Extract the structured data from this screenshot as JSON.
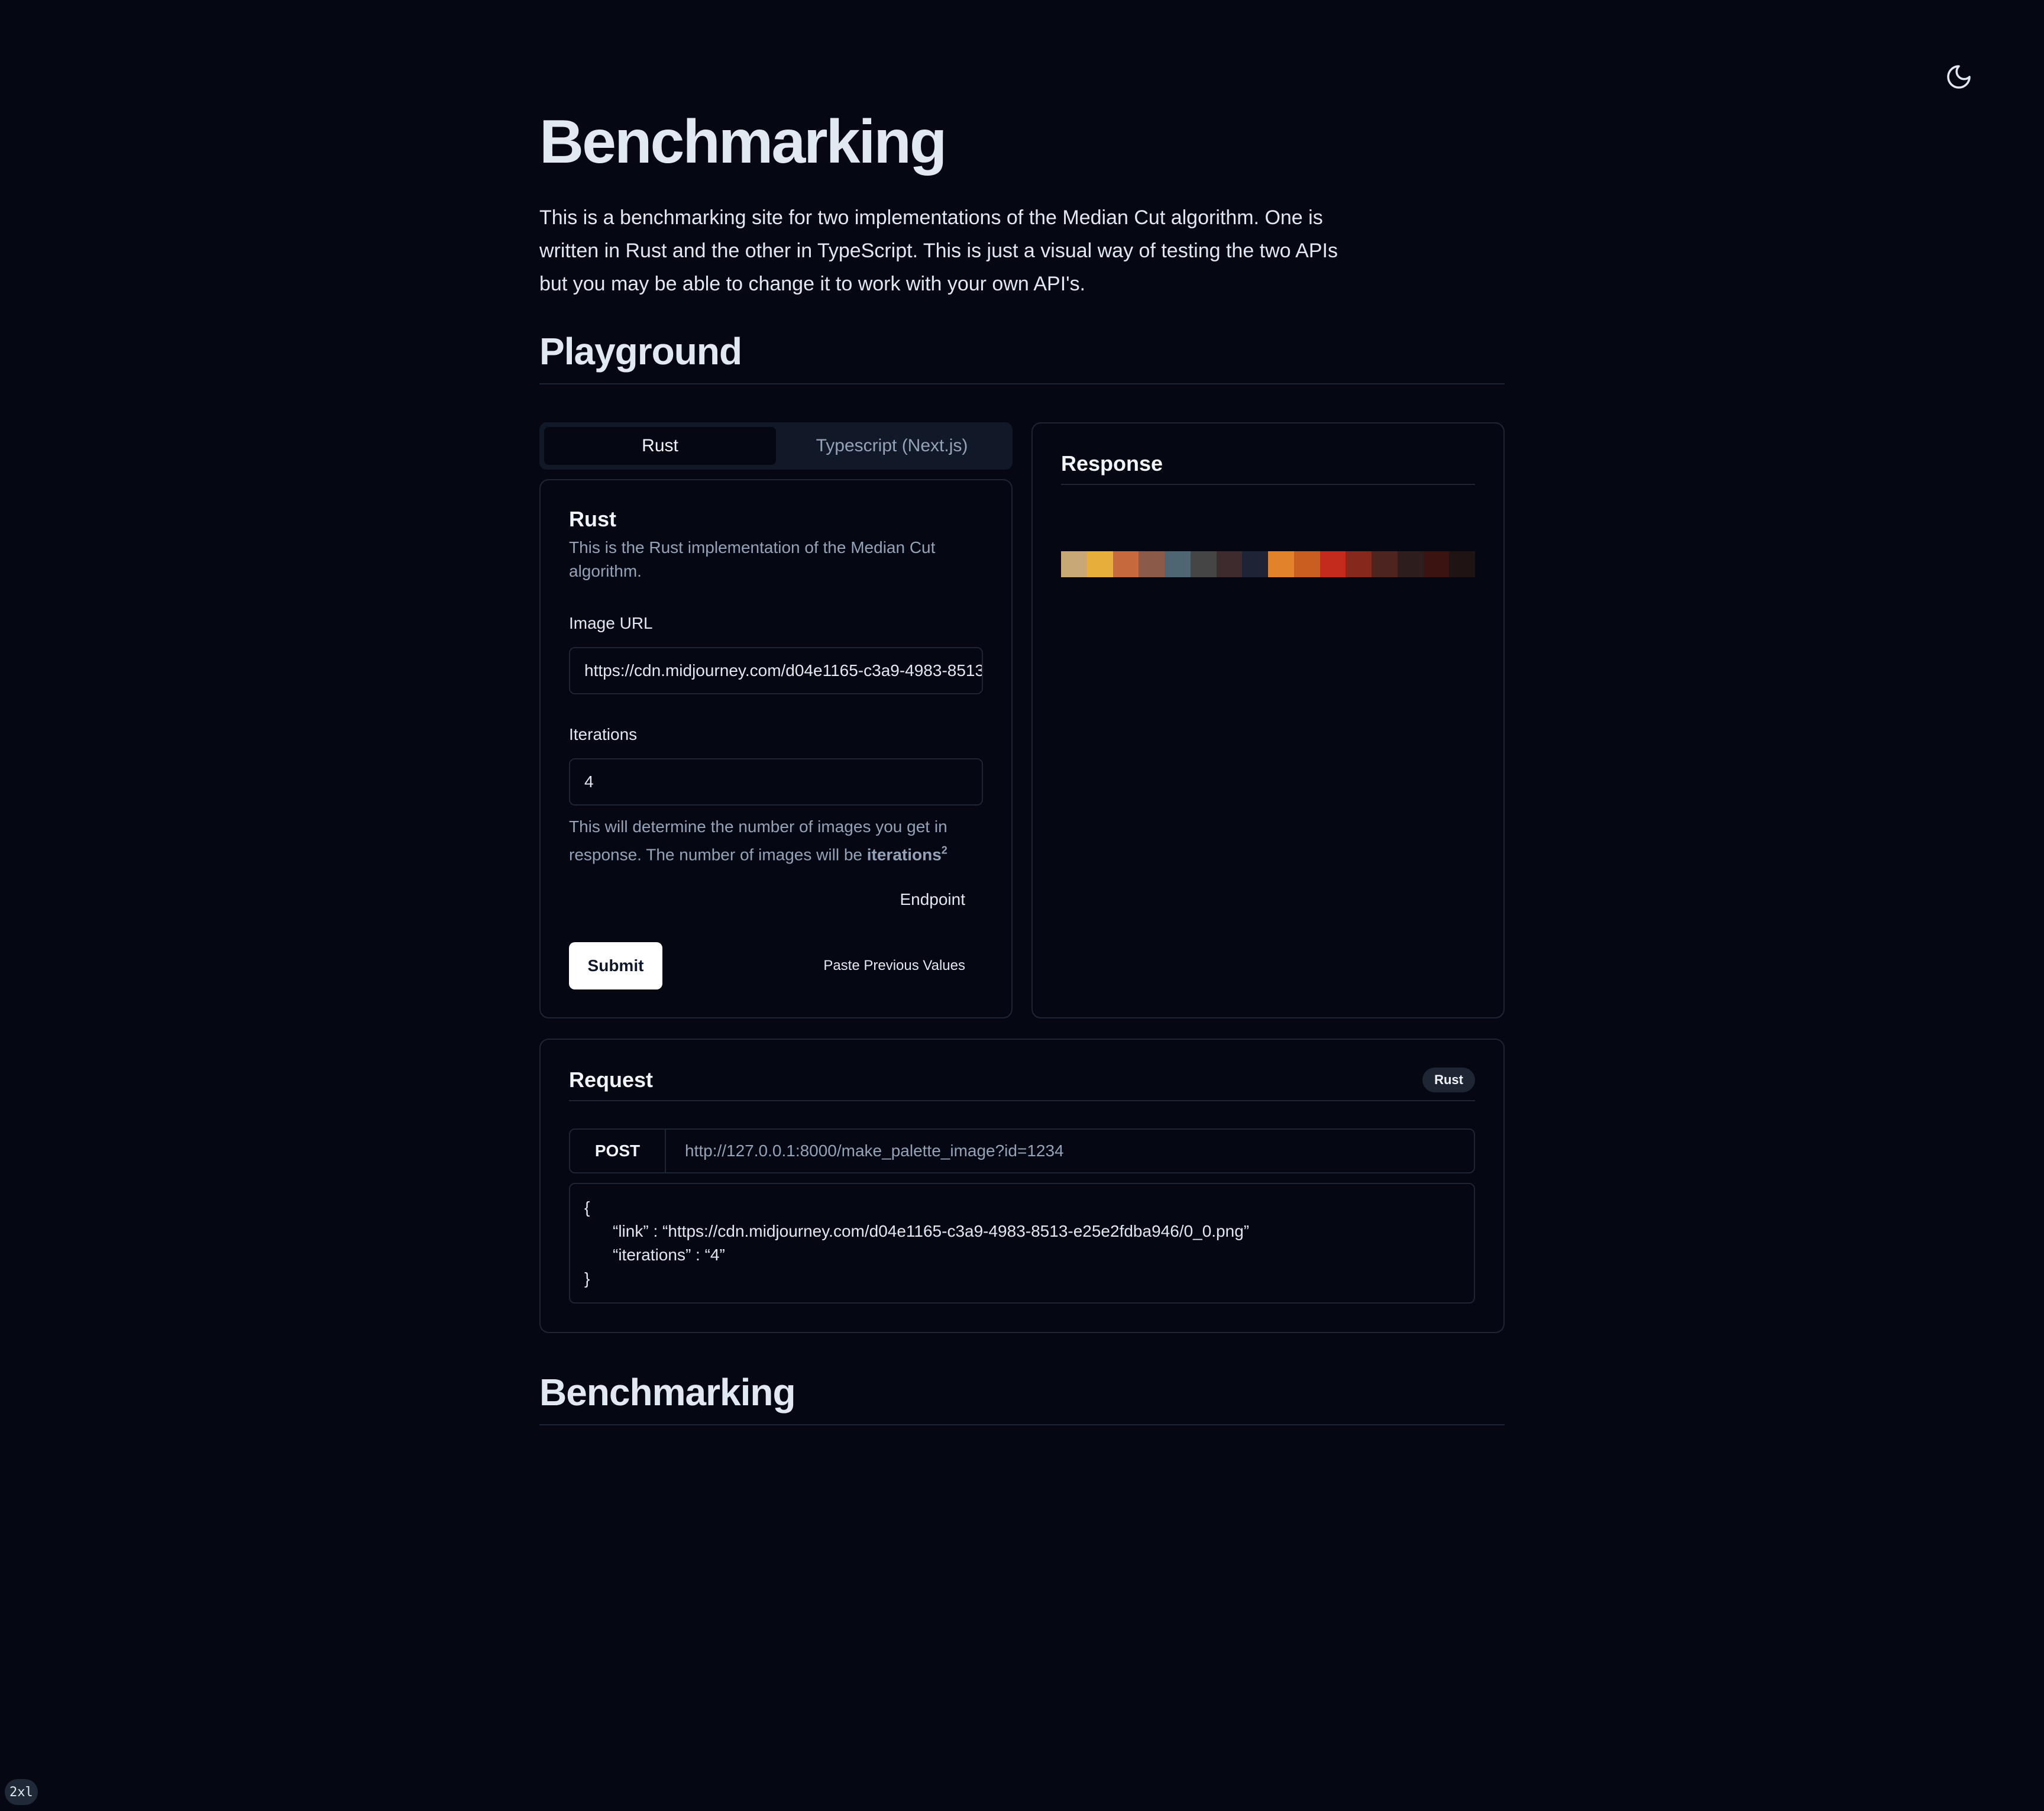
{
  "header": {
    "theme_toggle_icon": "moon-icon"
  },
  "hero": {
    "title": "Benchmarking",
    "intro": "This is a benchmarking site for two implementations of the Median Cut algorithm. One is written in Rust and the other in TypeScript. This is just a visual way of testing the two APIs but you may be able to change it to work with your own API's."
  },
  "playground": {
    "title": "Playground",
    "tabs": [
      {
        "label": "Rust",
        "active": true
      },
      {
        "label": "Typescript (Next.js)",
        "active": false
      }
    ],
    "form": {
      "title": "Rust",
      "description": "This is the Rust implementation of the Median Cut algorithm.",
      "image_url_label": "Image URL",
      "image_url_value": "https://cdn.midjourney.com/d04e1165-c3a9-4983-8513-e25e2fdba946/0_0.png",
      "iterations_label": "Iterations",
      "iterations_value": "4",
      "help_text": "This will determine the number of images you get in response. The number of images will be ",
      "help_bold": "iterations",
      "help_sup": "2",
      "endpoint_label": "Endpoint",
      "submit_label": "Submit",
      "paste_label": "Paste Previous Values"
    },
    "response": {
      "title": "Response",
      "palette": [
        "#c9a877",
        "#e8ae3a",
        "#c46a3d",
        "#8c5a48",
        "#4d6672",
        "#454546",
        "#3d2b2e",
        "#1d2436",
        "#e2822a",
        "#c85e1f",
        "#c42b1c",
        "#86281c",
        "#4e2421",
        "#2e1d1d",
        "#3b1412",
        "#1f1314"
      ]
    }
  },
  "request": {
    "title": "Request",
    "badge": "Rust",
    "method": "POST",
    "url": "http://127.0.0.1:8000/make_palette_image?id=1234",
    "body_open": "{",
    "body_link": "“link” : “https://cdn.midjourney.com/d04e1165-c3a9-4983-8513-e25e2fdba946/0_0.png”",
    "body_iterations": "“iterations” : “4”",
    "body_close": "}"
  },
  "benchmarking": {
    "title": "Benchmarking"
  },
  "breakpoint_indicator": "2xl"
}
